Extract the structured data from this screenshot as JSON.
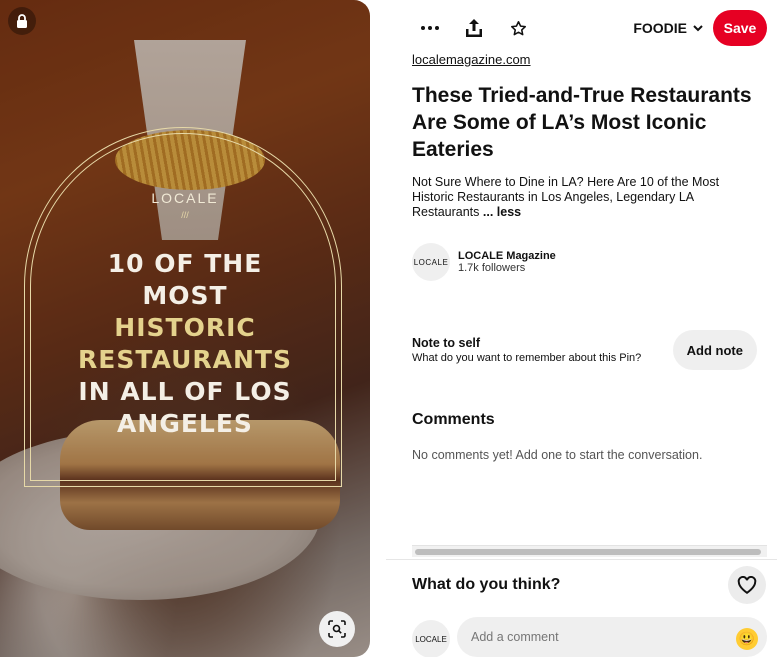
{
  "pin_image": {
    "brand": "LOCALE",
    "brand_mark": "///",
    "headline_lines": [
      {
        "text": "10 OF THE",
        "style": "white"
      },
      {
        "text": "MOST",
        "style": "white"
      },
      {
        "text": "HISTORIC",
        "style": "gold"
      },
      {
        "text": "RESTAURANTS",
        "style": "gold"
      },
      {
        "text": "IN ALL OF LOS",
        "style": "white"
      },
      {
        "text": "ANGELES",
        "style": "white"
      }
    ],
    "colors": {
      "gold": "#e4d28d",
      "white": "#f4efe6"
    }
  },
  "toolbar": {
    "more_icon": "more-horizontal-icon",
    "share_icon": "share-icon",
    "favorite_icon": "star-icon",
    "board_label": "FOODIE",
    "save_label": "Save",
    "accent": "#e60023"
  },
  "pin": {
    "source": "localemagazine.com",
    "title": "These Tried-and-True Restaurants Are Some of LA’s Most Iconic Eateries",
    "description": "Not Sure Where to Dine in LA? Here Are 10 of the Most Historic Restaurants in Los Angeles, Legendary LA Restaurants",
    "less_label": "... less"
  },
  "creator": {
    "avatar_text": "LOCALE",
    "name": "LOCALE Magazine",
    "followers": "1.7k followers"
  },
  "note": {
    "title": "Note to self",
    "subtitle": "What do you want to remember about this Pin?",
    "button": "Add note"
  },
  "comments": {
    "title": "Comments",
    "empty": "No comments yet! Add one to start the conversation."
  },
  "composer": {
    "prompt": "What do you think?",
    "avatar_text": "LOCALE",
    "placeholder": "Add a comment",
    "emoji": "😃"
  }
}
